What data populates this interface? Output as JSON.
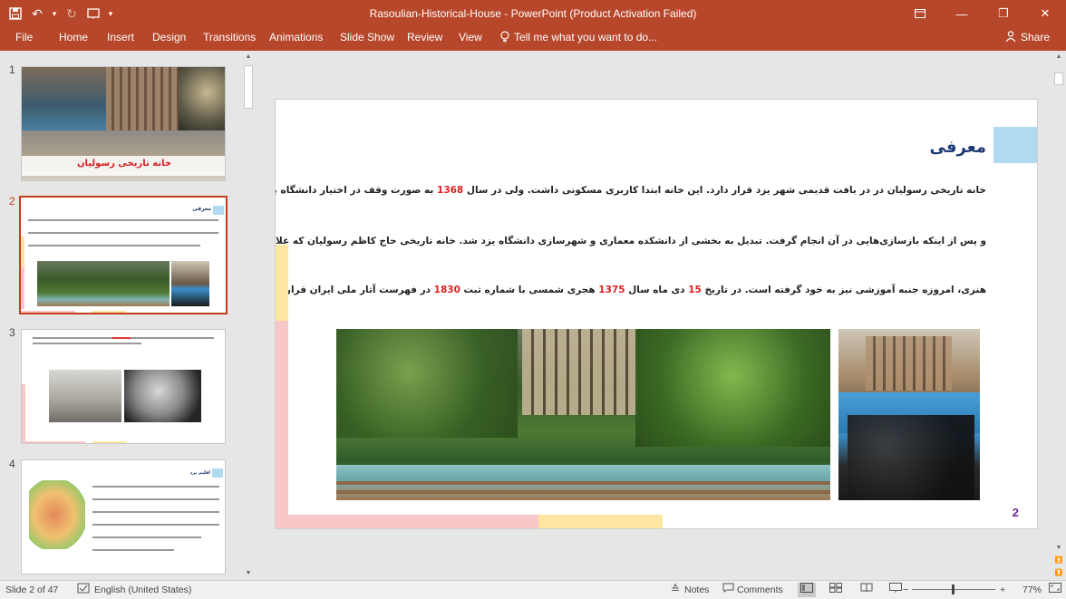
{
  "window": {
    "title": "Rasoulian-Historical-House  -  PowerPoint (Product Activation Failed)",
    "quick_access": [
      "save-icon",
      "undo-icon",
      "redo-icon",
      "start-from-beginning-icon",
      "customize-qat-icon"
    ]
  },
  "ribbon": {
    "tabs": [
      "File",
      "Home",
      "Insert",
      "Design",
      "Transitions",
      "Animations",
      "Slide Show",
      "Review",
      "View"
    ],
    "tell_me": "Tell me what you want to do...",
    "share": "Share"
  },
  "thumbnails": {
    "numbers": [
      "1",
      "2",
      "3",
      "4"
    ],
    "slide1_caption": "خانه تاریخی رسولیان",
    "slide2_title": "معرفی",
    "slide4_title": "اقلیم یزد",
    "selected": 2
  },
  "slide": {
    "title": "معرفی",
    "line1_a": "خانه تاریخی رسولیان در در بافت قدیمی شهر یزد قرار دارد. این خانه ابتدا کاربری مسکونی داشت. ولی در سال ",
    "line1_num": "1368",
    "line1_b": " به صورت وقف در اختیار دانشگاه یزد قرار گرفت",
    "line2": "و پس از اینکه بازسازی‌هایی در آن انجام گرفت. تبدیل به بخشی از دانشکده معماری و شهرسازی دانشگاه یزد شد. خانه تاریخی حاج کاظم رسولیان که علاوه بر جنبه",
    "line3_a": "هنری، امروزه جنبه آموزشی نیز به خود گرفته است. در تاریخ ",
    "line3_num1": "15",
    "line3_b": " دی ماه سال ",
    "line3_num2": "1375",
    "line3_c": " هجری شمسی با شماره ثبت ",
    "line3_num3": "1830",
    "line3_d": " در فهرست آثار ملی ایران قرار گرفت.",
    "number": "2"
  },
  "status": {
    "slide_info": "Slide 2 of 47",
    "language": "English (United States)",
    "notes": "Notes",
    "comments": "Comments",
    "zoom": "77%"
  },
  "colors": {
    "accent": "#b7472a",
    "title_blue": "#1f3a73",
    "highlight_red": "#e02020",
    "deco_yellow": "#fde6a0",
    "deco_pink": "#f8c8c8",
    "title_box": "#b1d9f0"
  }
}
